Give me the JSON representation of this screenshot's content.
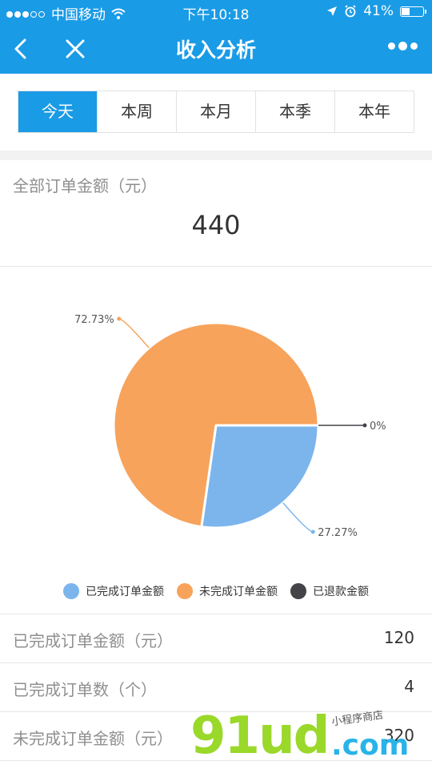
{
  "status_bar": {
    "carrier": "中国移动",
    "time": "下午10:18",
    "battery": "41%",
    "battery_level": 0.41,
    "signal_bars": 3
  },
  "nav": {
    "title": "收入分析"
  },
  "tabs": [
    {
      "label": "今天",
      "active": true
    },
    {
      "label": "本周",
      "active": false
    },
    {
      "label": "本月",
      "active": false
    },
    {
      "label": "本季",
      "active": false
    },
    {
      "label": "本年",
      "active": false
    }
  ],
  "summary": {
    "label": "全部订单金额（元）",
    "value": "440"
  },
  "chart_data": {
    "type": "pie",
    "slices": [
      {
        "name": "已完成订单金额",
        "value": 120,
        "label": "27.27%",
        "color": "#7cb5ec"
      },
      {
        "name": "未完成订单金额",
        "value": 320,
        "label": "72.73%",
        "color": "#f7a35c"
      },
      {
        "name": "已退款金额",
        "value": 0,
        "label": "0%",
        "color": "#434348"
      }
    ],
    "legend_position": "bottom"
  },
  "rows": [
    {
      "label": "已完成订单金额（元）",
      "value": "120"
    },
    {
      "label": "已完成订单数（个）",
      "value": "4"
    },
    {
      "label": "未完成订单金额（元）",
      "value": "320"
    }
  ],
  "watermark": {
    "brand": "91ud",
    "domain": ".com",
    "tagline": "小程序商店"
  },
  "colors": {
    "accent": "#1a9be6",
    "text_muted": "#8f8f8f"
  }
}
